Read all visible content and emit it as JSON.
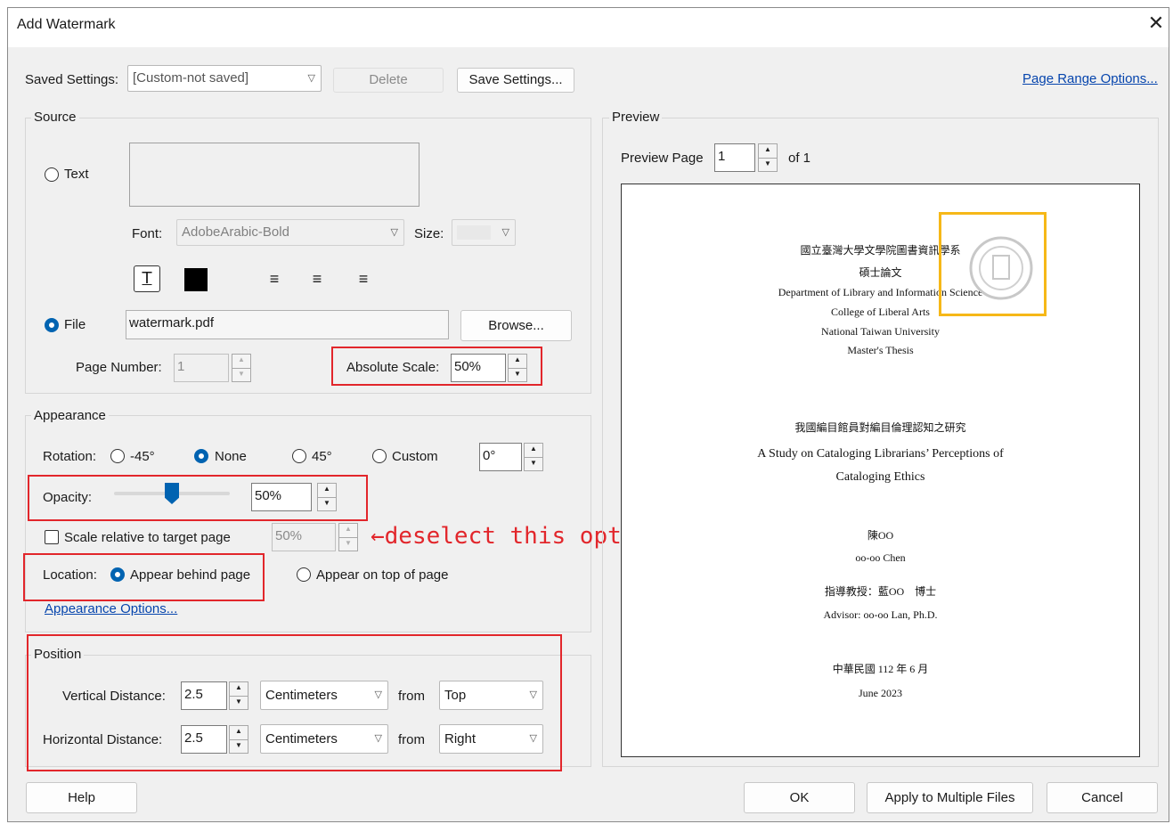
{
  "window": {
    "title": "Add Watermark",
    "close_glyph": "✕"
  },
  "saved_settings": {
    "label": "Saved Settings:",
    "value": "[Custom-not saved]",
    "delete": "Delete",
    "save": "Save Settings...",
    "page_range": "Page Range Options..."
  },
  "source": {
    "heading": "Source",
    "text_option": "Text",
    "font_label": "Font:",
    "font_value": "AdobeArabic-Bold",
    "size_label": "Size:",
    "file_option": "File",
    "file_value": "watermark.pdf",
    "browse": "Browse...",
    "page_number_label": "Page Number:",
    "page_number_value": "1",
    "absolute_scale_label": "Absolute Scale:",
    "absolute_scale_value": "50%"
  },
  "appearance": {
    "heading": "Appearance",
    "rotation_label": "Rotation:",
    "rot_neg45": "-45°",
    "rot_none": "None",
    "rot_45": "45°",
    "rot_custom": "Custom",
    "rot_custom_value": "0°",
    "opacity_label": "Opacity:",
    "opacity_value": "50%",
    "opacity_level": 0.5,
    "scale_relative_label": "Scale relative to target page",
    "scale_relative_value": "50%",
    "location_label": "Location:",
    "behind": "Appear behind page",
    "on_top": "Appear on top of page",
    "options_link": "Appearance Options..."
  },
  "position": {
    "heading": "Position",
    "vertical_label": "Vertical Distance:",
    "vertical_value": "2.5",
    "vertical_unit": "Centimeters",
    "vertical_from_label": "from",
    "vertical_from": "Top",
    "horizontal_label": "Horizontal Distance:",
    "horizontal_value": "2.5",
    "horizontal_unit": "Centimeters",
    "horizontal_from_label": "from",
    "horizontal_from": "Right"
  },
  "preview": {
    "heading": "Preview",
    "page_label": "Preview Page",
    "page_value": "1",
    "of_label": "of 1",
    "doc_lines": [
      "國立臺灣大學文學院圖書資訊學系",
      "碩士論文",
      "Department of Library and Information Science",
      "College of Liberal Arts",
      "National Taiwan University",
      "Master's Thesis",
      "我國編目館員對編目倫理認知之研究",
      "A Study on Cataloging Librarians’ Perceptions of",
      "Cataloging Ethics",
      "陳OO",
      "oo-oo Chen",
      "指導教授：藍OO　博士",
      "Advisor: oo-oo Lan, Ph.D.",
      "中華民國 112 年 6 月",
      "June 2023"
    ]
  },
  "annotation": {
    "text": "←deselect this option",
    "color": "#e2262b"
  },
  "buttons": {
    "help": "Help",
    "ok": "OK",
    "apply": "Apply to Multiple Files",
    "cancel": "Cancel"
  }
}
